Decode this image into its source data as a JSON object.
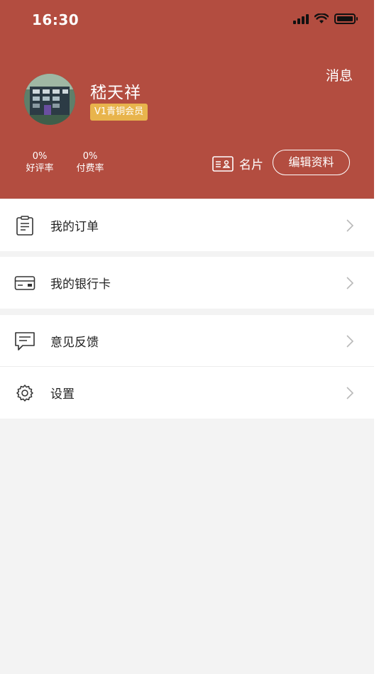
{
  "status_bar": {
    "time": "16:30"
  },
  "header": {
    "messages_label": "消息",
    "username": "嵇天祥",
    "member_badge": "V1青铜会员",
    "stats": [
      {
        "value": "0%",
        "label": "好评率"
      },
      {
        "value": "0%",
        "label": "付费率"
      }
    ],
    "card_label": "名片",
    "edit_button_label": "编辑资料",
    "background_color": "#b34d40",
    "badge_color": "#e8b44c"
  },
  "menu": {
    "items": [
      {
        "label": "我的订单",
        "icon": "clipboard-icon"
      },
      {
        "label": "我的银行卡",
        "icon": "credit-card-icon"
      },
      {
        "label": "意见反馈",
        "icon": "chat-message-icon"
      },
      {
        "label": "设置",
        "icon": "gear-icon"
      }
    ]
  }
}
